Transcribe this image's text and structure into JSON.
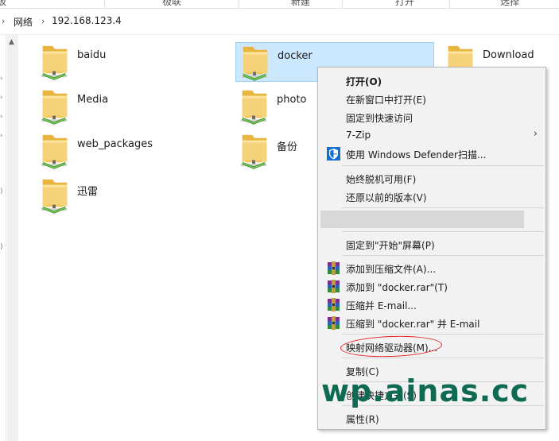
{
  "ribbon": {
    "groups": [
      "极联",
      "新建",
      "打开",
      "选择"
    ]
  },
  "address": {
    "crumbs": [
      "网络",
      "192.168.123.4"
    ]
  },
  "items": [
    {
      "label": "baidu"
    },
    {
      "label": "docker"
    },
    {
      "label": "Download"
    },
    {
      "label": "Media"
    },
    {
      "label": "photo"
    },
    {
      "label": "web_packages"
    },
    {
      "label": "备份"
    },
    {
      "label": "迅雷"
    }
  ],
  "context_menu": {
    "items": [
      {
        "label": "打开(O)"
      },
      {
        "label": "在新窗口中打开(E)"
      },
      {
        "label": "固定到快速访问"
      },
      {
        "label": "7-Zip"
      },
      {
        "label": "使用 Windows Defender扫描..."
      },
      {
        "label": "始终脱机可用(F)"
      },
      {
        "label": "还原以前的版本(V)"
      },
      {
        "label": "固定到\"开始\"屏幕(P)"
      },
      {
        "label": "添加到压缩文件(A)..."
      },
      {
        "label": "添加到 \"docker.rar\"(T)"
      },
      {
        "label": "压缩并 E-mail..."
      },
      {
        "label": "压缩到 \"docker.rar\" 并 E-mail"
      },
      {
        "label": "映射网络驱动器(M)..."
      },
      {
        "label": "复制(C)"
      },
      {
        "label": "创建快捷方式(S)"
      },
      {
        "label": "属性(R)"
      }
    ]
  },
  "watermark": {
    "text": "wp.ainas.cc"
  },
  "colors": {
    "selection": "#cce8ff",
    "annotation": "#e02020",
    "watermark": "#0e6a52"
  }
}
